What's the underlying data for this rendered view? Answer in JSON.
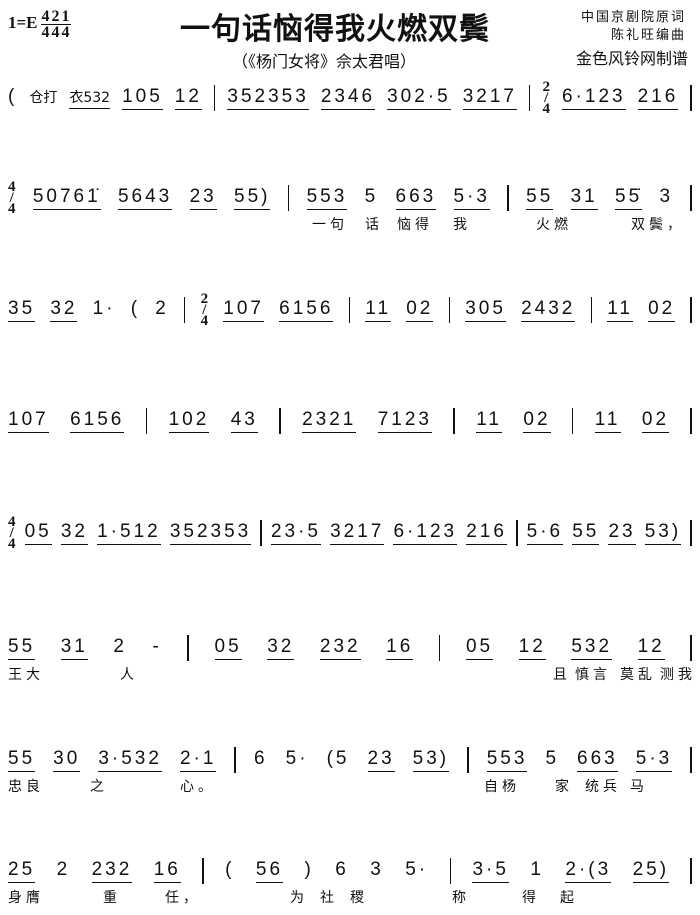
{
  "header": {
    "key": "1=E",
    "meters": [
      [
        "4",
        "4"
      ],
      [
        "2",
        "4"
      ],
      [
        "1",
        "4"
      ]
    ],
    "title": "一句话恼得我火燃双鬓",
    "subtitle": "（《杨门女将》佘太君唱）",
    "credits": [
      "中国京剧院原词",
      "陈礼旺编曲",
      "金色风铃网制谱"
    ]
  },
  "systems": [
    {
      "tokens": [
        "(",
        "仓打",
        "衣532",
        "105",
        "12",
        "|",
        "352353",
        "2346",
        "302·5",
        "3217",
        "|",
        "2/4",
        "6·123",
        "216",
        "|"
      ],
      "lyrics": []
    },
    {
      "tokens": [
        "4/4",
        "50761̇",
        "5643",
        "23",
        "55)",
        "|",
        "553",
        "5",
        "663",
        "5·3",
        "|",
        "55",
        "31",
        "55̇",
        "3",
        "|"
      ],
      "lyrics": [
        "一句",
        "话",
        "恼得",
        "我",
        "火燃",
        "双鬓，"
      ]
    },
    {
      "tokens": [
        "35",
        "32",
        "1·",
        "(",
        "2",
        "|",
        "2/4",
        "107",
        "6156",
        "|",
        "11",
        "02",
        "|",
        "305",
        "2432",
        "|",
        "11",
        "02",
        "|"
      ],
      "lyrics": []
    },
    {
      "tokens": [
        "107",
        "6156",
        "|",
        "102",
        "43",
        "|",
        "2321",
        "7123",
        "|",
        "11",
        "02",
        "|",
        "11",
        "02",
        "|"
      ],
      "lyrics": []
    },
    {
      "tokens": [
        "4/4",
        "05",
        "32",
        "1·512",
        "352353",
        "|",
        "23·5",
        "3217",
        "6·123",
        "216",
        "|",
        "5·6",
        "55",
        "23",
        "53)",
        "|"
      ],
      "lyrics": []
    },
    {
      "tokens": [
        "55",
        "31",
        "2",
        "-",
        "|",
        "05",
        "32",
        "232",
        "16",
        "|",
        "05",
        "12",
        "532",
        "12",
        "|"
      ],
      "lyrics": [
        "王大",
        "人",
        "且",
        "慎言",
        "莫乱",
        "测我"
      ]
    },
    {
      "tokens": [
        "55",
        "30",
        "3·532",
        "2·1",
        "|",
        "6",
        "5·",
        "(5",
        "23",
        "53)",
        "|",
        "553",
        "5",
        "663",
        "5·3",
        "|"
      ],
      "lyrics": [
        "忠良",
        "之",
        "心。",
        "自杨",
        "家",
        "统兵",
        "马"
      ]
    },
    {
      "tokens": [
        "25",
        "2",
        "232",
        "16",
        "|",
        "(",
        "56",
        ")",
        "6",
        "3",
        "5·",
        "|",
        "3·5",
        "1",
        "2·(3",
        "25)",
        "|"
      ],
      "lyrics": [
        "身膺",
        "重",
        "任，",
        "为",
        "社",
        "稷",
        "称",
        "得",
        "起"
      ]
    }
  ]
}
